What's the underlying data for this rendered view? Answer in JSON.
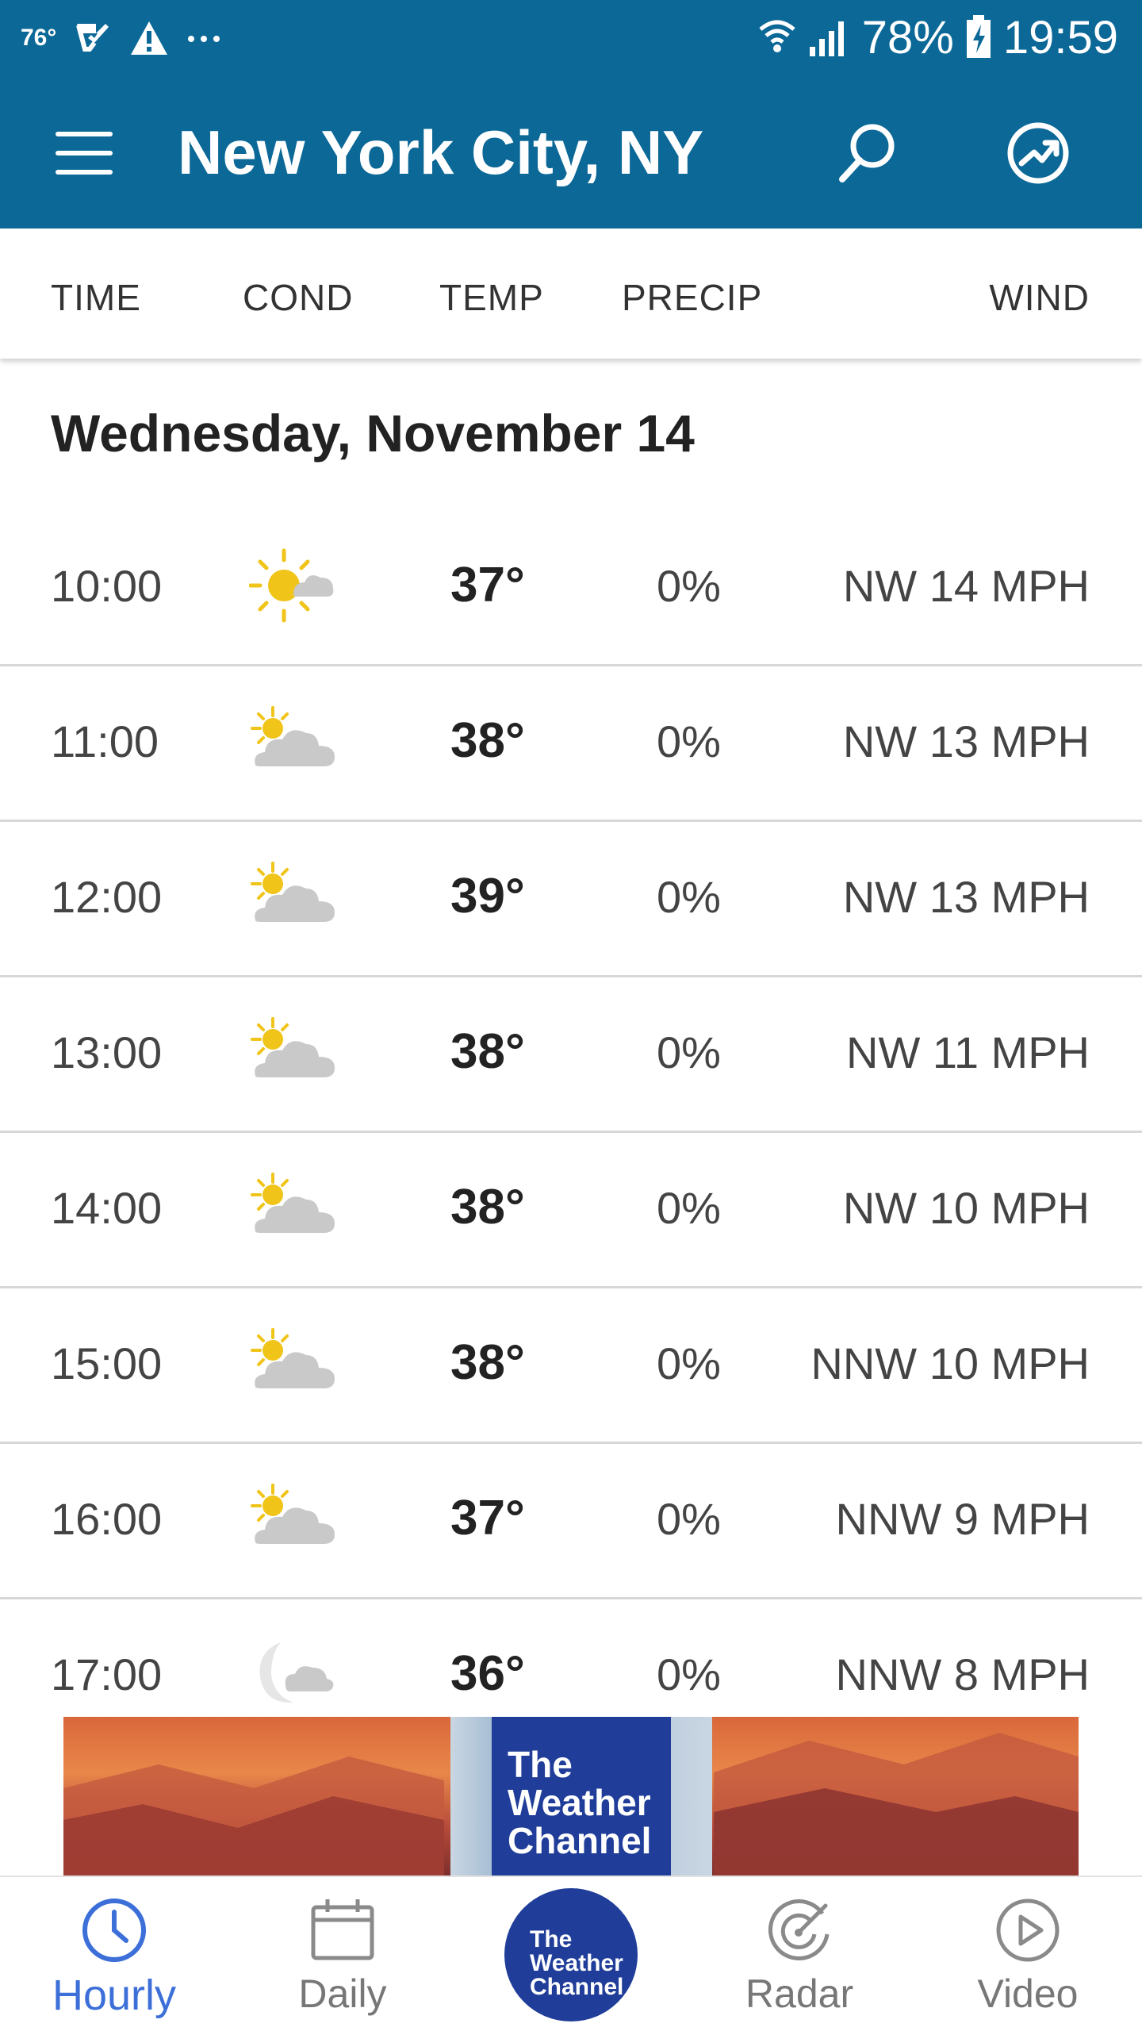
{
  "status_bar": {
    "temp": "76°",
    "battery": "78%",
    "time": "19:59"
  },
  "app_bar": {
    "title": "New York City, NY"
  },
  "columns": {
    "time": "TIME",
    "cond": "COND",
    "temp": "TEMP",
    "precip": "PRECIP",
    "wind": "WIND"
  },
  "day_heading": "Wednesday, November 14",
  "rows": [
    {
      "time": "10:00",
      "cond_icon": "sunny-partly-cloudy-icon",
      "temp": "37°",
      "precip": "0%",
      "wind": "NW 14 MPH"
    },
    {
      "time": "11:00",
      "cond_icon": "partly-cloudy-icon",
      "temp": "38°",
      "precip": "0%",
      "wind": "NW 13 MPH"
    },
    {
      "time": "12:00",
      "cond_icon": "partly-cloudy-icon",
      "temp": "39°",
      "precip": "0%",
      "wind": "NW 13 MPH"
    },
    {
      "time": "13:00",
      "cond_icon": "partly-cloudy-icon",
      "temp": "38°",
      "precip": "0%",
      "wind": "NW 11 MPH"
    },
    {
      "time": "14:00",
      "cond_icon": "partly-cloudy-icon",
      "temp": "38°",
      "precip": "0%",
      "wind": "NW 10 MPH"
    },
    {
      "time": "15:00",
      "cond_icon": "partly-cloudy-icon",
      "temp": "38°",
      "precip": "0%",
      "wind": "NNW 10 MPH"
    },
    {
      "time": "16:00",
      "cond_icon": "partly-cloudy-icon",
      "temp": "37°",
      "precip": "0%",
      "wind": "NNW 9 MPH"
    },
    {
      "time": "17:00",
      "cond_icon": "night-partly-cloudy-icon",
      "temp": "36°",
      "precip": "0%",
      "wind": "NNW 8 MPH"
    }
  ],
  "ad": {
    "logo_line1": "The",
    "logo_line2": "Weather",
    "logo_line3": "Channel"
  },
  "bottom_nav": {
    "hourly": "Hourly",
    "daily": "Daily",
    "logo_line1": "The",
    "logo_line2": "Weather",
    "logo_line3": "Channel",
    "radar": "Radar",
    "video": "Video"
  },
  "colors": {
    "header": "#0b6897",
    "active": "#3d6fd9",
    "sun": "#f0c419",
    "cloud": "#c9c9c9",
    "brand": "#1f3d99"
  }
}
